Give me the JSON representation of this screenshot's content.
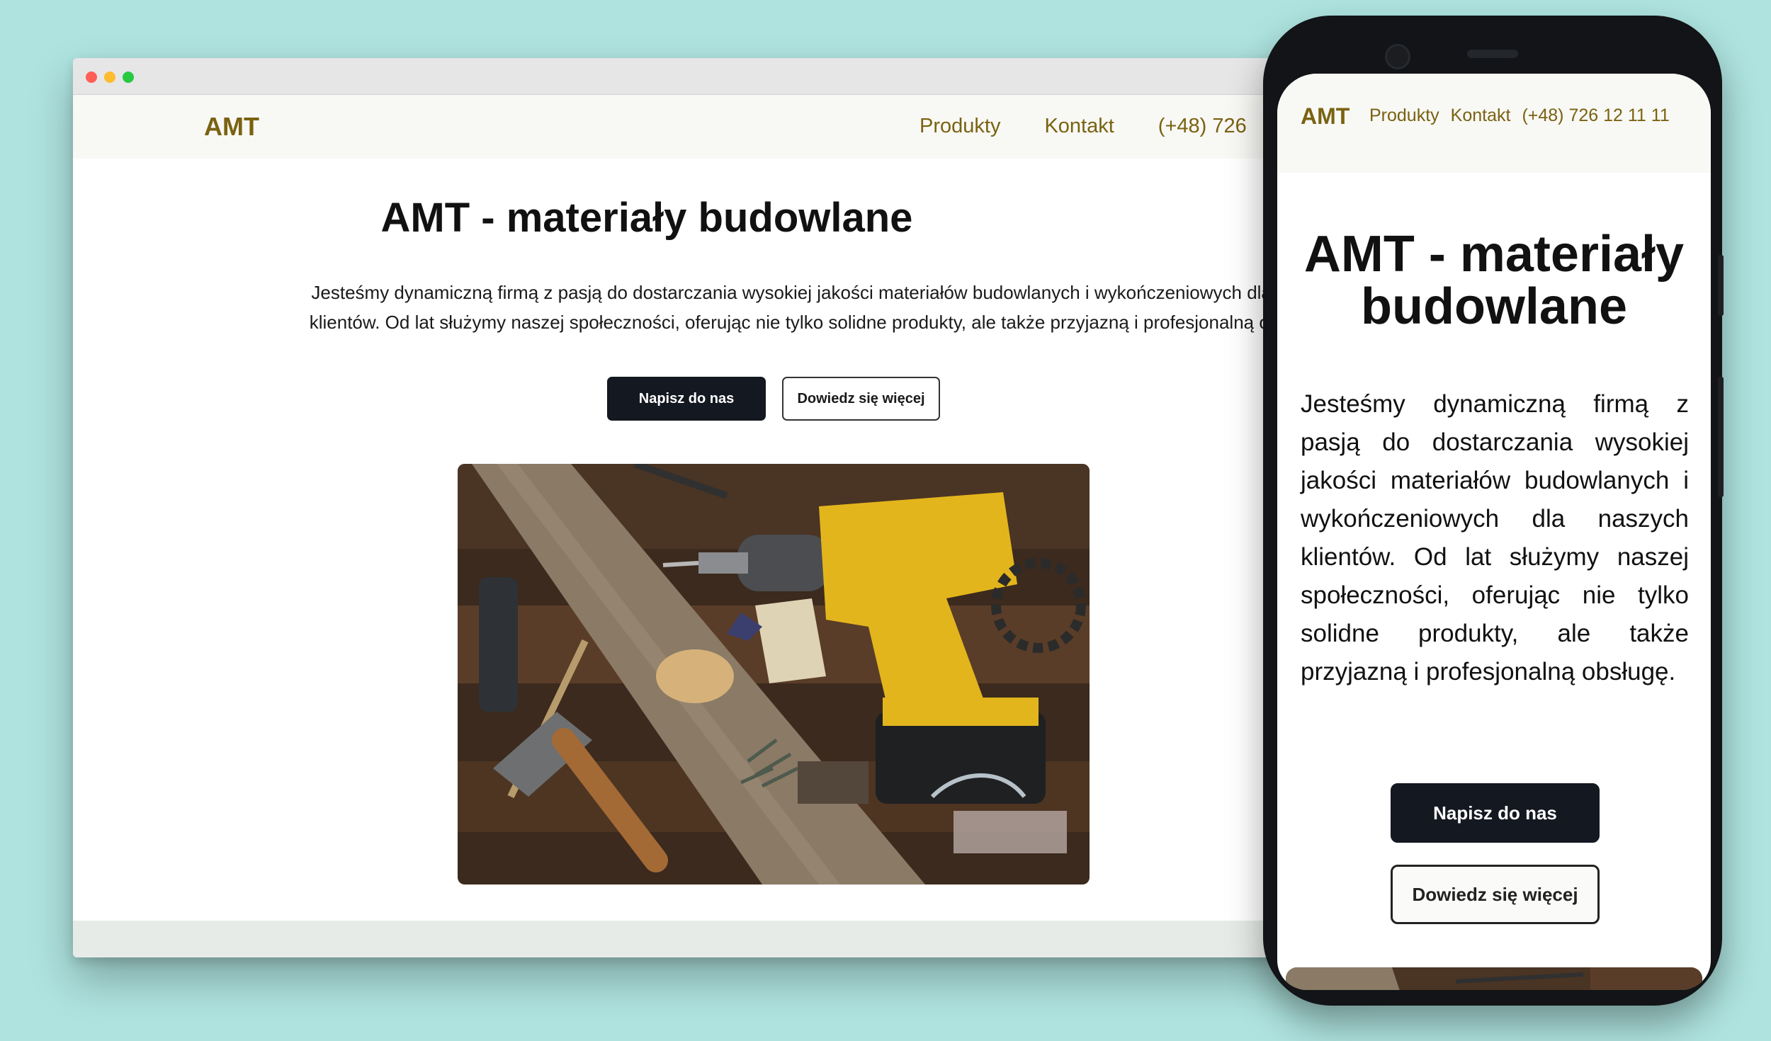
{
  "colors": {
    "background": "#aee3df",
    "brand": "#7a6211",
    "primary_button": "#141821"
  },
  "desktop": {
    "window_controls": [
      "close",
      "minimize",
      "maximize"
    ],
    "header": {
      "logo": "AMT",
      "nav": [
        "Produkty",
        "Kontakt",
        "(+48) 726"
      ]
    },
    "hero": {
      "title": "AMT - materiały budowlane",
      "line1": "Jesteśmy dynamiczną firmą z pasją do dostarczania wysokiej jakości materiałów budowlanych i wykończeniowych dla n",
      "line2": "klientów. Od lat służymy naszej społeczności, oferując nie tylko solidne produkty, ale także przyjazną i profesjonalną obs",
      "primary_button": "Napisz do nas",
      "secondary_button": "Dowiedz się więcej",
      "image_icon": "tools-photo-icon"
    }
  },
  "mobile": {
    "header": {
      "logo": "AMT",
      "nav": [
        "Produkty",
        "Kontakt",
        "(+48) 726 12 11 11"
      ]
    },
    "hero": {
      "title": "AMT - materiały budowlane",
      "text": "Jesteśmy dynamiczną firmą z pasją do dostarczania wysokiej jakości materiałów budowlanych i wykończeniowych dla naszych klientów. Od lat służymy naszej społeczności, oferując nie tylko solidne produkty, ale także przyjazną i profesjonalną obsługę.",
      "primary_button": "Napisz do nas",
      "secondary_button": "Dowiedz się więcej"
    }
  }
}
